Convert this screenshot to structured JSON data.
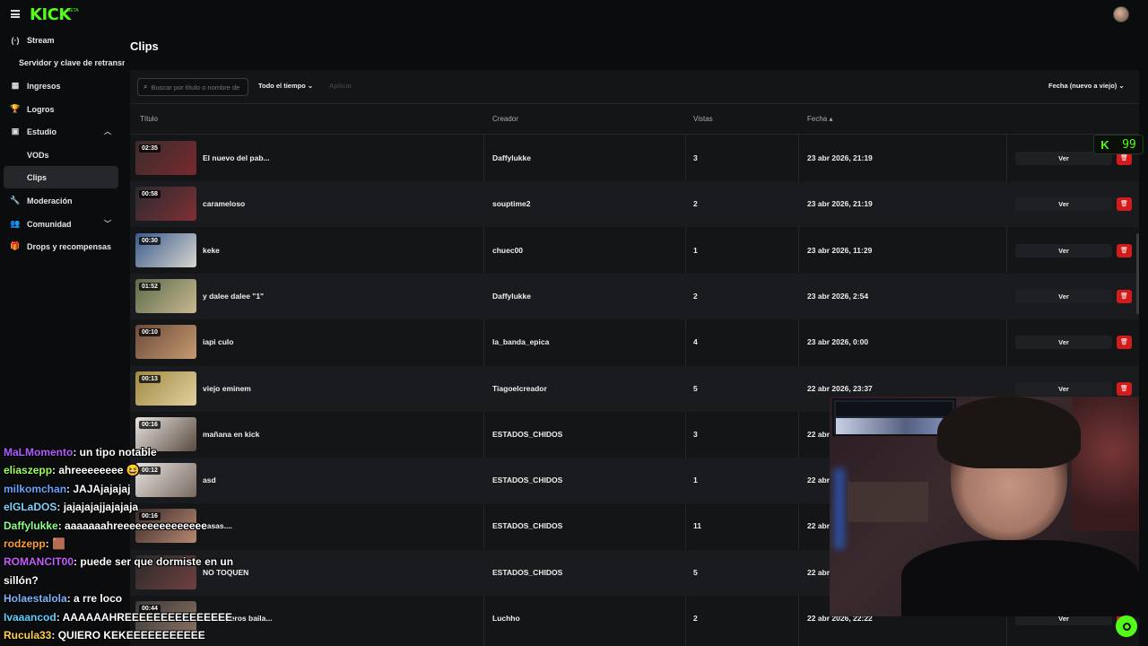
{
  "brand": {
    "logo": "KICK",
    "beta": "BETA"
  },
  "sidebar": {
    "stream": "Stream",
    "stream_key": "Servidor y clave de retransmisión",
    "ingresos": "Ingresos",
    "logros": "Logros",
    "estudio": "Estudio",
    "vods": "VODs",
    "clips": "Clips",
    "moderacion": "Moderación",
    "comunidad": "Comunidad",
    "drops": "Drops y recompensas"
  },
  "page": {
    "title": "Clips"
  },
  "filters": {
    "search_placeholder": "Buscar por título o nombre de creador",
    "time": "Todo el tiempo",
    "muted": "Aplicar",
    "sort": "Fecha (nuevo a viejo)"
  },
  "table": {
    "headers": {
      "title": "Título",
      "creator": "Creador",
      "views": "Vistas",
      "date": "Fecha"
    },
    "view_label": "Ver",
    "rows": [
      {
        "duration": "02:35",
        "title": "El nuevo del pab...",
        "creator": "Daffylukke",
        "views": "3",
        "date": "23 abr 2026, 21:19"
      },
      {
        "duration": "00:58",
        "title": "carameloso",
        "creator": "souptime2",
        "views": "2",
        "date": "23 abr 2026, 21:19"
      },
      {
        "duration": "00:30",
        "title": "keke",
        "creator": "chuec00",
        "views": "1",
        "date": "23 abr 2026, 11:29"
      },
      {
        "duration": "01:52",
        "title": "y dalee dalee \"1\"",
        "creator": "Daffylukke",
        "views": "2",
        "date": "23 abr 2026, 2:54"
      },
      {
        "duration": "00:10",
        "title": "iapi culo",
        "creator": "la_banda_epica",
        "views": "4",
        "date": "23 abr 2026, 0:00"
      },
      {
        "duration": "00:13",
        "title": "viejo eminem",
        "creator": "Tiagoelcreador",
        "views": "5",
        "date": "22 abr 2026, 23:37"
      },
      {
        "duration": "00:16",
        "title": "mañana en kick",
        "creator": "ESTADOS_CHIDOS",
        "views": "3",
        "date": "22 abr"
      },
      {
        "duration": "00:12",
        "title": "asd",
        "creator": "ESTADOS_CHIDOS",
        "views": "1",
        "date": "22 abr"
      },
      {
        "duration": "00:16",
        "title": "casas....",
        "creator": "ESTADOS_CHIDOS",
        "views": "11",
        "date": "22 abr"
      },
      {
        "duration": "",
        "title": "NO TOQUEN",
        "creator": "ESTADOS_CHIDOS",
        "views": "5",
        "date": "22 abr"
      },
      {
        "duration": "00:44",
        "title": "Challeperos baila...",
        "creator": "Luchho",
        "views": "2",
        "date": "22 abr 2026, 22:22"
      }
    ]
  },
  "overlay_badge": {
    "value": "99"
  },
  "chat": [
    {
      "user": "MaLMomento",
      "color": "#b05cff",
      "text": "un tipo notable"
    },
    {
      "user": "eliaszepp",
      "color": "#9dff5c",
      "text": "ahreeeeeeee 😆"
    },
    {
      "user": "milkomchan",
      "color": "#6aa3ff",
      "text": "JAJAjajajaj"
    },
    {
      "user": "elGLaDOS",
      "color": "#7dd3ff",
      "text": "jajajajajjajajaja"
    },
    {
      "user": "Daffylukke",
      "color": "#8dff8d",
      "text": "aaaaaaahreeeeeeeeeeeeeee"
    },
    {
      "user": "rodzepp",
      "color": "#ff9f2e",
      "text": "🟫"
    },
    {
      "user": "ROMANCIT00",
      "color": "#c55cff",
      "text": "puede ser que dormiste en un"
    },
    {
      "user": "",
      "color": "#ffffff",
      "text": "sillón?"
    },
    {
      "user": "Holaestalola",
      "color": "#7fb5ff",
      "text": "a rre loco"
    },
    {
      "user": "Ivaaancod",
      "color": "#5cd1ff",
      "text": "AAAAAAHREEEEEEEEEEEEEEE"
    },
    {
      "user": "Rucula33",
      "color": "#ffd04a",
      "text": "QUIERO KEKEEEEEEEEEEE"
    }
  ]
}
